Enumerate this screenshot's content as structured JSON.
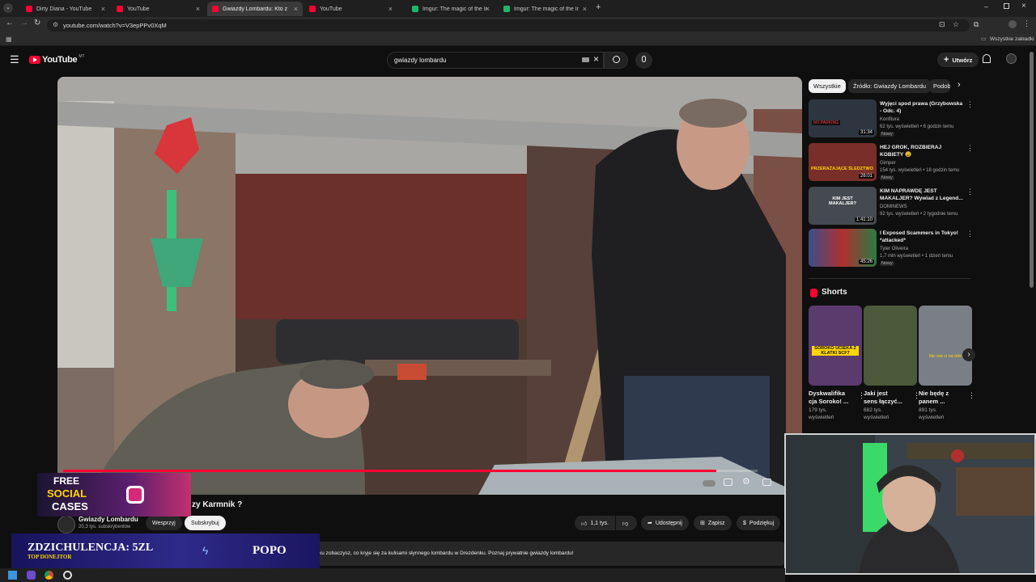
{
  "browser": {
    "tabs": [
      {
        "title": "Dirty Diana - YouTube",
        "color": "#ff0033"
      },
      {
        "title": "YouTube",
        "color": "#ff0033"
      },
      {
        "title": "Gwiazdy Lombardu: Kto zb...",
        "color": "#ff0033"
      },
      {
        "title": "YouTube",
        "color": "#ff0033"
      },
      {
        "title": "Imgur: The magic of the Interne",
        "color": "#1bb76e"
      },
      {
        "title": "Imgur: The magic of the Interne",
        "color": "#1bb76e"
      }
    ],
    "url": "youtube.com/watch?v=V3epPPv0XqM",
    "bookmarks_label": "Wszystkie zakładki"
  },
  "youtube": {
    "logo_text": "YouTube",
    "logo_region": "MT",
    "search_value": "gwiazdy lombardu",
    "create_label": "Utwórz"
  },
  "video": {
    "title_partial": "zy Karmnik ?",
    "progress": 0.94,
    "channel_name": "Gwiazdy Lombardu",
    "subscribers": "20,3 tys. subskrybentów",
    "support_label": "Wesprzyj",
    "subscribe_label": "Subskrybuj",
    "likes": "1,1 tys.",
    "share_label": "Udostępnij",
    "save_label": "Zapisz",
    "thanks_label": "Podziękuj",
    "description": "ku zobaczysz, co kryje się za kulisami słynnego lombardu w Drezdenku. Poznaj prywatnie gwiazdy lombardu!"
  },
  "chips": [
    "Wszystkie",
    "Źródło: Gwiazdy Lombardu",
    "Podob"
  ],
  "recommendations": [
    {
      "title": "Wyjęci spod prawa (Grzybowska - Odc. 4)",
      "channel": "Konfitura",
      "meta": "62 tys. wyświetleń • 6 godzin temu",
      "badge": "Nowy",
      "duration": "31:34",
      "thumb_text": "NO PARKING",
      "color": "#2d3640"
    },
    {
      "title": "HEJ GROK, ROZBIERAJ KOBIETY 😩",
      "channel": "Gimper",
      "meta": "154 tys. wyświetleń • 18 godzin temu",
      "badge": "Nowy",
      "duration": "26:01",
      "thumb_text": "PRZERAŻAJĄCE ŚLEDZTWO",
      "color": "#7a2e2a"
    },
    {
      "title": "KIM NAPRAWDĘ JEST MAKALJER? Wywiad z Legend...",
      "channel": "DOMINEWS",
      "meta": "92 tys. wyświetleń • 2 tygodnie temu",
      "badge": "",
      "duration": "1:41:10",
      "thumb_text": "KIM JEST MAKALJER?",
      "color": "#454a50"
    },
    {
      "title": "I Exposed Scammers in Tokyo! *attacked*",
      "channel": "Tyler Oliveira",
      "meta": "1,7 mln wyświetleń • 1 dzień temu",
      "badge": "Nowy",
      "duration": "45:26",
      "thumb_text": "",
      "color": "#3a4f8a"
    }
  ],
  "shorts": {
    "header": "Shorts",
    "items": [
      {
        "title": "Dyskwalifika\ncja Sorokо! ...",
        "views": "179 tys.\nwyświetleń",
        "thumb_text": "SOROKO UCIEKA Z KLATKI SCF7",
        "color": "#5b3a6e"
      },
      {
        "title": "Jaki jest\nsens łączyć...",
        "views": "682 tys.\nwyświetleń",
        "thumb_text": "",
        "color": "#4a5a3a"
      },
      {
        "title": "Nie będę z\npanem ...",
        "views": "891 tys.\nwyświetleń",
        "thumb_text": "Nic nie ci na tele",
        "color": "#7a7f86"
      }
    ]
  },
  "overlays": {
    "promo_line1": "FREE",
    "promo_line2": "SOCIAL",
    "promo_line3": "CASES",
    "donation_text": "ZDZICHULENCJA: 5ZL",
    "donation_sub": "TOP DONEJTOR",
    "donation_right": "POPO"
  },
  "colors": {
    "accent": "#ff0033",
    "background": "#0f0f0f"
  }
}
